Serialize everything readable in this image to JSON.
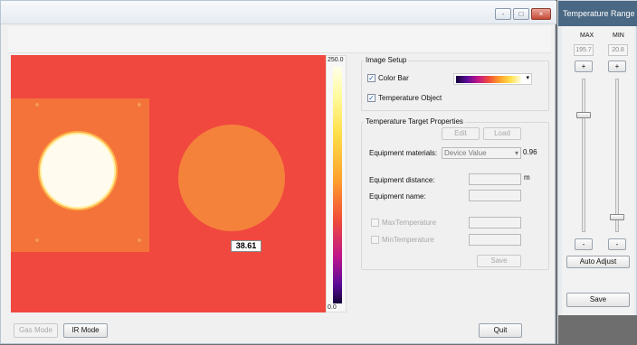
{
  "titlebar": {
    "minimize": "-",
    "restore": "□",
    "close": "×"
  },
  "colorbar": {
    "max_label": "250.0",
    "min_label": "0.0"
  },
  "thermal_view": {
    "readout": "38.61"
  },
  "image_setup": {
    "title": "Image Setup",
    "color_bar_label": "Color Bar",
    "color_bar_checked": "✓",
    "temperature_object_label": "Temperature Object",
    "temperature_object_checked": "✓",
    "dropdown_arrow": "▾"
  },
  "target_props": {
    "title": "Temperature Target Properties",
    "edit_label": "Edit",
    "load_label": "Load",
    "materials_label": "Equipment materials:",
    "materials_value": "Device Value",
    "materials_arrow": "▾",
    "emissivity": "0.96",
    "distance_label": "Equipment distance:",
    "distance_unit": "m",
    "name_label": "Equipment name:",
    "max_temp_label": "MaxTemperature",
    "min_temp_label": "MinTemperature",
    "save_label": "Save"
  },
  "bottom_bar": {
    "gas_mode": "Gas Mode",
    "ir_mode": "IR Mode",
    "quit": "Quit"
  },
  "temperature_range": {
    "title": "Temperature Range",
    "max_header": "MAX",
    "min_header": "MIN",
    "max_value": "195.7",
    "min_value": "20.8",
    "plus": "+",
    "minus": "-",
    "auto_adjust_label": "Auto Adjust",
    "save_label": "Save"
  }
}
